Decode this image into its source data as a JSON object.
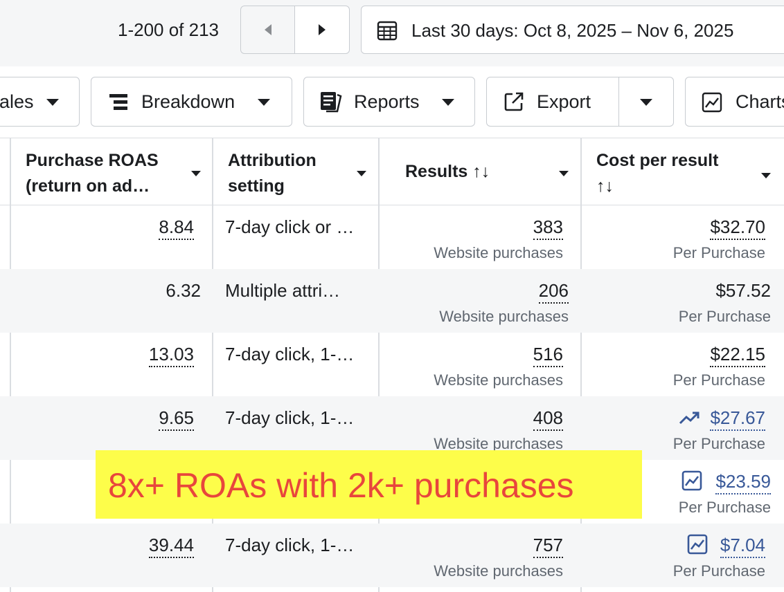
{
  "pagination": {
    "range": "1-200 of 213"
  },
  "date_range": {
    "label": "Last 30 days: Oct 8, 2025 – Nov 6, 2025"
  },
  "toolbar": {
    "partial_label": "ales",
    "breakdown": "Breakdown",
    "reports": "Reports",
    "export": "Export",
    "charts": "Charts"
  },
  "columns": {
    "roas_line1": "Purchase ROAS",
    "roas_line2": "(return on ad…",
    "attr_line1": "Attribution",
    "attr_line2": "setting",
    "results": "Results ↑↓",
    "cpr_line1": "Cost per result",
    "cpr_line2": "↑↓"
  },
  "rows": [
    {
      "roas": "8.84",
      "attribution": "7-day click or …",
      "results": "383",
      "results_sub": "Website purchases",
      "cost": "$32.70",
      "cost_sub": "Per Purchase"
    },
    {
      "roas": "6.32",
      "attribution": "Multiple attri…",
      "results": "206",
      "results_sub": "Website purchases",
      "cost": "$57.52",
      "cost_sub": "Per Purchase"
    },
    {
      "roas": "13.03",
      "attribution": "7-day click, 1-…",
      "results": "516",
      "results_sub": "Website purchases",
      "cost": "$22.15",
      "cost_sub": "Per Purchase"
    },
    {
      "roas": "9.65",
      "attribution": "7-day click, 1-…",
      "results": "408",
      "results_sub": "Website purchases",
      "cost": "$27.67",
      "cost_sub": "Per Purchase"
    },
    {
      "roas": "",
      "attribution": "",
      "results": "",
      "results_sub": "",
      "cost": "$23.59",
      "cost_sub": "Per Purchase"
    },
    {
      "roas": "39.44",
      "attribution": "7-day click, 1-…",
      "results": "757",
      "results_sub": "Website purchases",
      "cost": "$7.04",
      "cost_sub": "Per Purchase"
    }
  ],
  "annotation": {
    "text": "8x+ ROAs with 2k+  purchases"
  },
  "colors": {
    "link": "#385898",
    "highlight": "#fdfd4a",
    "annotation_text": "#e8463c"
  }
}
